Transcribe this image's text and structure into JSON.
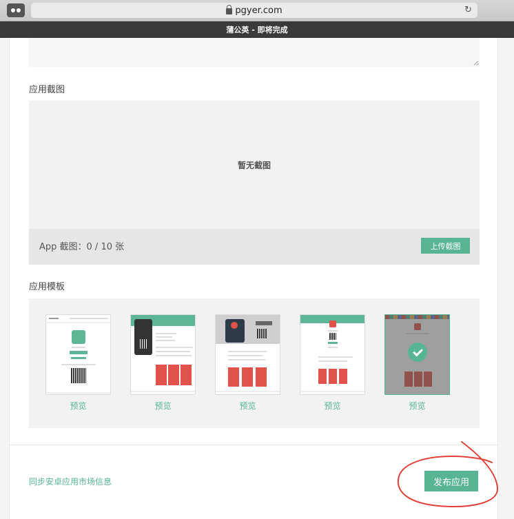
{
  "browser": {
    "url": "pgyer.com",
    "page_title": "蒲公英 - 即将完成",
    "reload_glyph": "↻"
  },
  "screenshots": {
    "section_label": "应用截图",
    "empty_text": "暂无截图",
    "count_text": "App 截图：0 / 10 张",
    "upload_label": "上传截图"
  },
  "templates": {
    "section_label": "应用模板",
    "items": [
      {
        "preview_label": "预览",
        "selected": false
      },
      {
        "preview_label": "预览",
        "selected": false
      },
      {
        "preview_label": "预览",
        "selected": false
      },
      {
        "preview_label": "预览",
        "selected": false
      },
      {
        "preview_label": "预览",
        "selected": true
      }
    ]
  },
  "footer": {
    "sync_link": "同步安卓应用市场信息",
    "publish_label": "发布应用"
  },
  "colors": {
    "accent": "#57b594",
    "annotation": "#e0403a"
  }
}
